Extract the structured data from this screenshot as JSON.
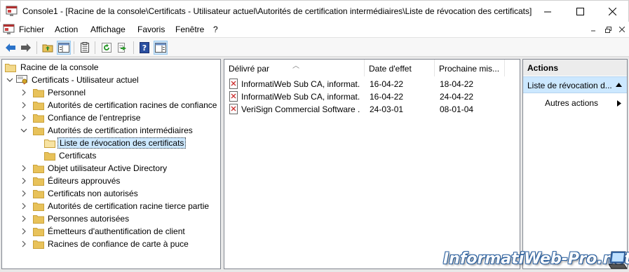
{
  "window": {
    "title": "Console1 - [Racine de la console\\Certificats - Utilisateur actuel\\Autorités de certification intermédiaires\\Liste de révocation des certificats]"
  },
  "menu": {
    "items": [
      "Fichier",
      "Action",
      "Affichage",
      "Favoris",
      "Fenêtre",
      "?"
    ]
  },
  "toolbar": {
    "buttons": [
      "back-icon",
      "forward-icon",
      "up-folder-icon",
      "show-hide-tree-icon",
      "properties-icon",
      "refresh-icon",
      "export-list-icon",
      "help-icon",
      "show-hide-action-pane-icon"
    ]
  },
  "tree": {
    "root": "Racine de la console",
    "store": "Certificats - Utilisateur actuel",
    "items": [
      "Personnel",
      "Autorités de certification racines de confiance",
      "Confiance de l'entreprise",
      "Autorités de certification intermédiaires",
      "Liste de révocation des certificats",
      "Certificats",
      "Objet utilisateur Active Directory",
      "Éditeurs approuvés",
      "Certificats non autorisés",
      "Autorités de certification racine tierce partie",
      "Personnes autorisées",
      "Émetteurs d'authentification de client",
      "Racines de confiance de carte à puce"
    ],
    "selected": "Liste de révocation des certificats"
  },
  "list": {
    "columns": [
      "Délivré par",
      "Date d'effet",
      "Prochaine mis..."
    ],
    "rows": [
      {
        "issuer": "InformatiWeb Sub CA, informat...",
        "effective": "16-04-22",
        "next": "18-04-22"
      },
      {
        "issuer": "InformatiWeb Sub CA, informat...",
        "effective": "16-04-22",
        "next": "24-04-22"
      },
      {
        "issuer": "VeriSign Commercial Software ...",
        "effective": "24-03-01",
        "next": "08-01-04"
      }
    ]
  },
  "actions": {
    "title": "Actions",
    "section": "Liste de révocation d...",
    "more": "Autres actions"
  },
  "watermark": "InformatiWeb-Pro.net",
  "colors": {
    "selection": "#cce8ff",
    "folder": "#e8c25a",
    "pane_border": "#828790",
    "toolbar_bg": "#f7f7f7"
  }
}
